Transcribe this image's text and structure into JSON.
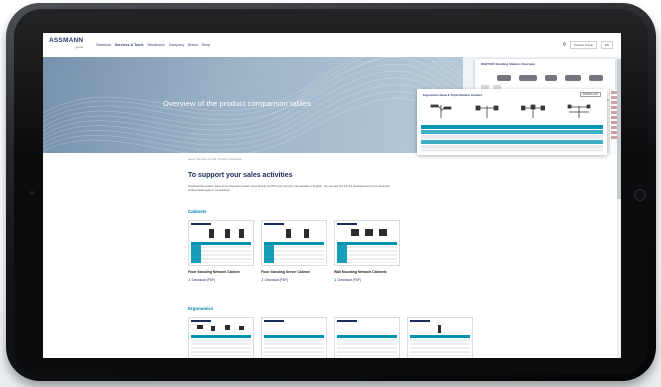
{
  "header": {
    "logo_text": "ASSMANN",
    "logo_sub": "group",
    "nav": [
      "Solutions",
      "Services & Tools",
      "Newsroom",
      "Company",
      "Brand",
      "Shop"
    ],
    "active_nav": "Services & Tools",
    "right_button_1": "Partner Portal",
    "right_button_2": "EN"
  },
  "hero": {
    "title": "Overview of the product comparison tables",
    "card1_title": "DIGITUS® Docking Stations Overview",
    "card2_title": "Ergonomic Desk & Triple Monitor Holders",
    "card2_button": "DOWNLOAD"
  },
  "breadcrumb": "Home / Services & Tools / Product Comparison",
  "content": {
    "heading": "To support your sales activities",
    "intro": "Download the product matrix of the respective product group directly as PDF (only currently only available in English). You can also find it in the download area of the respective product detail pages in our webshop.",
    "categories": [
      {
        "title": "Cabinets",
        "items": [
          {
            "label": "Floor Standing Network Cabinet",
            "download": "Download (PDF)"
          },
          {
            "label": "Floor Standing Server Cabinet",
            "download": "Download (PDF)"
          },
          {
            "label": "Wall Mounting Network Cabinets",
            "download": "Download (PDF)"
          }
        ]
      },
      {
        "title": "Ergonomics",
        "items": []
      }
    ]
  },
  "colors": {
    "brand": "#1a2b5c",
    "accent": "#0094b3",
    "link": "#0083b0"
  },
  "icons": {
    "search": "search-icon",
    "download": "download-icon"
  }
}
